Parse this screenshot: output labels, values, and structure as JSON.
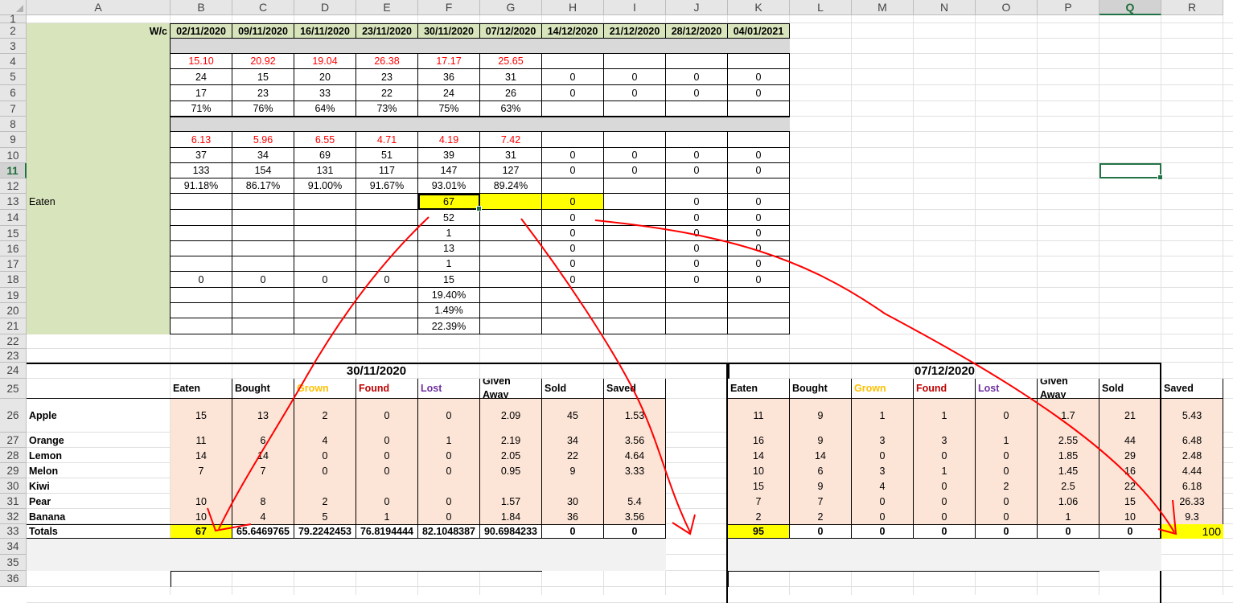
{
  "sheet": {
    "columns": [
      "A",
      "B",
      "C",
      "D",
      "E",
      "F",
      "G",
      "H",
      "I",
      "J",
      "K",
      "L",
      "M",
      "N",
      "O",
      "P",
      "Q",
      "R"
    ],
    "rows": [
      "1",
      "2",
      "3",
      "4",
      "5",
      "6",
      "7",
      "8",
      "9",
      "10",
      "11",
      "12",
      "13",
      "14",
      "15",
      "16",
      "17",
      "18",
      "19",
      "20",
      "21",
      "22",
      "23",
      "24",
      "25",
      "26",
      "27",
      "28",
      "29",
      "30",
      "31",
      "32",
      "33",
      "34",
      "35",
      "36"
    ],
    "selected_column": "Q",
    "selected_row": "11",
    "week_label": "W/c",
    "week_dates": [
      "02/11/2020",
      "09/11/2020",
      "16/11/2020",
      "23/11/2020",
      "30/11/2020",
      "07/12/2020",
      "14/12/2020",
      "21/12/2020",
      "28/12/2020",
      "04/01/2021"
    ],
    "top_rows": {
      "4": [
        "15.10",
        "20.92",
        "19.04",
        "26.38",
        "17.17",
        "25.65",
        "",
        "",
        "",
        ""
      ],
      "5": [
        "24",
        "15",
        "20",
        "23",
        "36",
        "31",
        "0",
        "0",
        "0",
        "0"
      ],
      "6": [
        "17",
        "23",
        "33",
        "22",
        "24",
        "26",
        "0",
        "0",
        "0",
        "0"
      ],
      "7": [
        "71%",
        "76%",
        "64%",
        "73%",
        "75%",
        "63%",
        "",
        "",
        "",
        ""
      ],
      "9": [
        "6.13",
        "5.96",
        "6.55",
        "4.71",
        "4.19",
        "7.42",
        "",
        "",
        "",
        ""
      ],
      "10": [
        "37",
        "34",
        "69",
        "51",
        "39",
        "31",
        "0",
        "0",
        "0",
        "0"
      ],
      "11": [
        "133",
        "154",
        "131",
        "117",
        "147",
        "127",
        "0",
        "0",
        "0",
        "0"
      ],
      "12": [
        "91.18%",
        "86.17%",
        "91.00%",
        "91.67%",
        "93.01%",
        "89.24%",
        "",
        "",
        "",
        ""
      ],
      "13": [
        "",
        "",
        "",
        "",
        "67",
        "",
        "0",
        "",
        "0",
        "0"
      ],
      "14": [
        "",
        "",
        "",
        "",
        "52",
        "",
        "0",
        "",
        "0",
        "0"
      ],
      "15": [
        "",
        "",
        "",
        "",
        "1",
        "",
        "0",
        "",
        "0",
        "0"
      ],
      "16": [
        "",
        "",
        "",
        "",
        "13",
        "",
        "0",
        "",
        "0",
        "0"
      ],
      "17": [
        "",
        "",
        "",
        "",
        "1",
        "",
        "0",
        "",
        "0",
        "0"
      ],
      "18": [
        "0",
        "0",
        "0",
        "0",
        "15",
        "",
        "0",
        "",
        "0",
        "0"
      ],
      "19": [
        "",
        "",
        "",
        "",
        "19.40%",
        "",
        "",
        "",
        "",
        ""
      ],
      "20": [
        "",
        "",
        "",
        "",
        "1.49%",
        "",
        "",
        "",
        "",
        ""
      ],
      "21": [
        "",
        "",
        "",
        "",
        "22.39%",
        "",
        "",
        "",
        "",
        ""
      ]
    },
    "row13_label": "Eaten",
    "block1_title": "30/11/2020",
    "block2_title": "07/12/2020",
    "block_headers": [
      "Eaten",
      "Bought",
      "Grown",
      "Found",
      "Lost",
      "Given Away",
      "Sold",
      "Saved"
    ],
    "fruits": [
      "Apple",
      "Orange",
      "Lemon",
      "Melon",
      "Kiwi",
      "Pear",
      "Banana"
    ],
    "block1_rows": [
      [
        "15",
        "13",
        "2",
        "0",
        "0",
        "2.09",
        "45",
        "1.53"
      ],
      [
        "11",
        "6",
        "4",
        "0",
        "1",
        "2.19",
        "34",
        "3.56"
      ],
      [
        "14",
        "14",
        "0",
        "0",
        "0",
        "2.05",
        "22",
        "4.64"
      ],
      [
        "7",
        "7",
        "0",
        "0",
        "0",
        "0.95",
        "9",
        "3.33"
      ],
      [
        "",
        "",
        "",
        "",
        "",
        "",
        "",
        ""
      ],
      [
        "10",
        "8",
        "2",
        "0",
        "0",
        "1.57",
        "30",
        "5.4"
      ],
      [
        "10",
        "4",
        "5",
        "1",
        "0",
        "1.84",
        "36",
        "3.56"
      ]
    ],
    "block2_rows": [
      [
        "11",
        "9",
        "1",
        "1",
        "0",
        "1.7",
        "21",
        "5.43"
      ],
      [
        "16",
        "9",
        "3",
        "3",
        "1",
        "2.55",
        "44",
        "6.48"
      ],
      [
        "14",
        "14",
        "0",
        "0",
        "0",
        "1.85",
        "29",
        "2.48"
      ],
      [
        "10",
        "6",
        "3",
        "1",
        "0",
        "1.45",
        "16",
        "4.44"
      ],
      [
        "15",
        "9",
        "4",
        "0",
        "2",
        "2.5",
        "22",
        "6.18"
      ],
      [
        "7",
        "7",
        "0",
        "0",
        "0",
        "1.06",
        "15",
        "26.33"
      ],
      [
        "2",
        "2",
        "0",
        "0",
        "0",
        "1",
        "10",
        "9.3"
      ]
    ],
    "totals_label": "Totals",
    "block1_totals": [
      "67",
      "65.6469765",
      "79.2242453",
      "76.8194444",
      "82.1048387",
      "90.6984233",
      "0",
      "0"
    ],
    "block2_totals": [
      "95",
      "0",
      "0",
      "0",
      "0",
      "0",
      "0",
      "0"
    ],
    "r33_value": "100"
  },
  "colors": {
    "label_fill": "#d8e4bc",
    "band_fill": "#d9d9d9",
    "peach_fill": "#fce4d6",
    "highlight": "#ffff00",
    "red_text": "#ff0000",
    "grown_text": "#ffc000",
    "found_text": "#c00000",
    "lost_text": "#7030a0",
    "annotation": "#ff0000"
  }
}
